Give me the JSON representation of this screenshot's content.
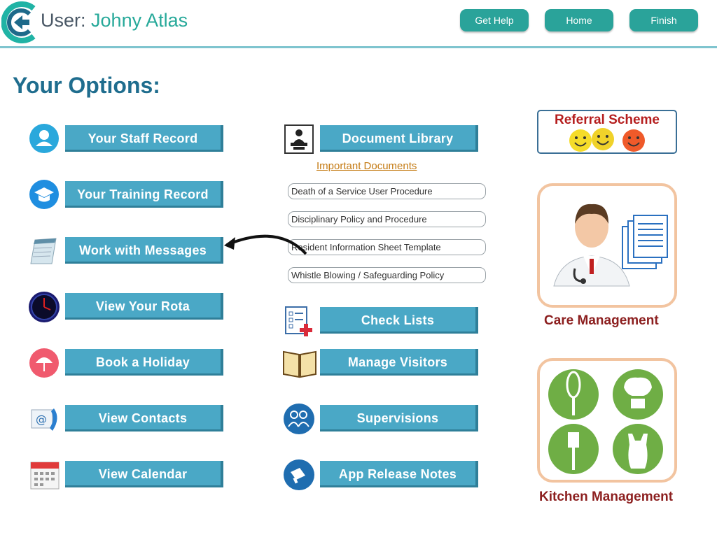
{
  "header": {
    "user_prefix": "User:",
    "user_name": "Johny Atlas",
    "buttons": [
      {
        "label": "Get Help"
      },
      {
        "label": "Home"
      },
      {
        "label": "Finish"
      }
    ]
  },
  "page_title": "Your Options:",
  "left_options": [
    {
      "label": "Your Staff Record",
      "icon": "user-icon"
    },
    {
      "label": "Your Training Record",
      "icon": "graduation-cap-icon"
    },
    {
      "label": "Work with Messages",
      "icon": "notepad-icon"
    },
    {
      "label": "View Your Rota",
      "icon": "clock-icon"
    },
    {
      "label": "Book a Holiday",
      "icon": "beach-umbrella-icon"
    },
    {
      "label": "View Contacts",
      "icon": "contact-phone-icon"
    },
    {
      "label": "View Calendar",
      "icon": "calendar-icon"
    }
  ],
  "middle_options": [
    {
      "label": "Document Library",
      "icon": "library-icon"
    },
    {
      "label": "Check Lists",
      "icon": "checklist-icon"
    },
    {
      "label": "Manage Visitors",
      "icon": "open-book-icon"
    },
    {
      "label": "Supervisions",
      "icon": "people-icon"
    },
    {
      "label": "App Release Notes",
      "icon": "megaphone-icon"
    }
  ],
  "important_documents": {
    "heading": "Important Documents",
    "items": [
      "Death of a Service User Procedure",
      "Disciplinary Policy and Procedure",
      "Resident Information Sheet Template",
      "Whistle Blowing / Safeguarding Policy"
    ]
  },
  "right_panel": {
    "referral": "Referral Scheme",
    "care": "Care Management",
    "kitchen": "Kitchen Management"
  },
  "colors": {
    "button_teal": "#2aa39a",
    "option_blue": "#4aa8c6",
    "title_blue": "#1f6d8e",
    "accent_red": "#8c1f1f",
    "kitchen_green": "#6fae45"
  }
}
